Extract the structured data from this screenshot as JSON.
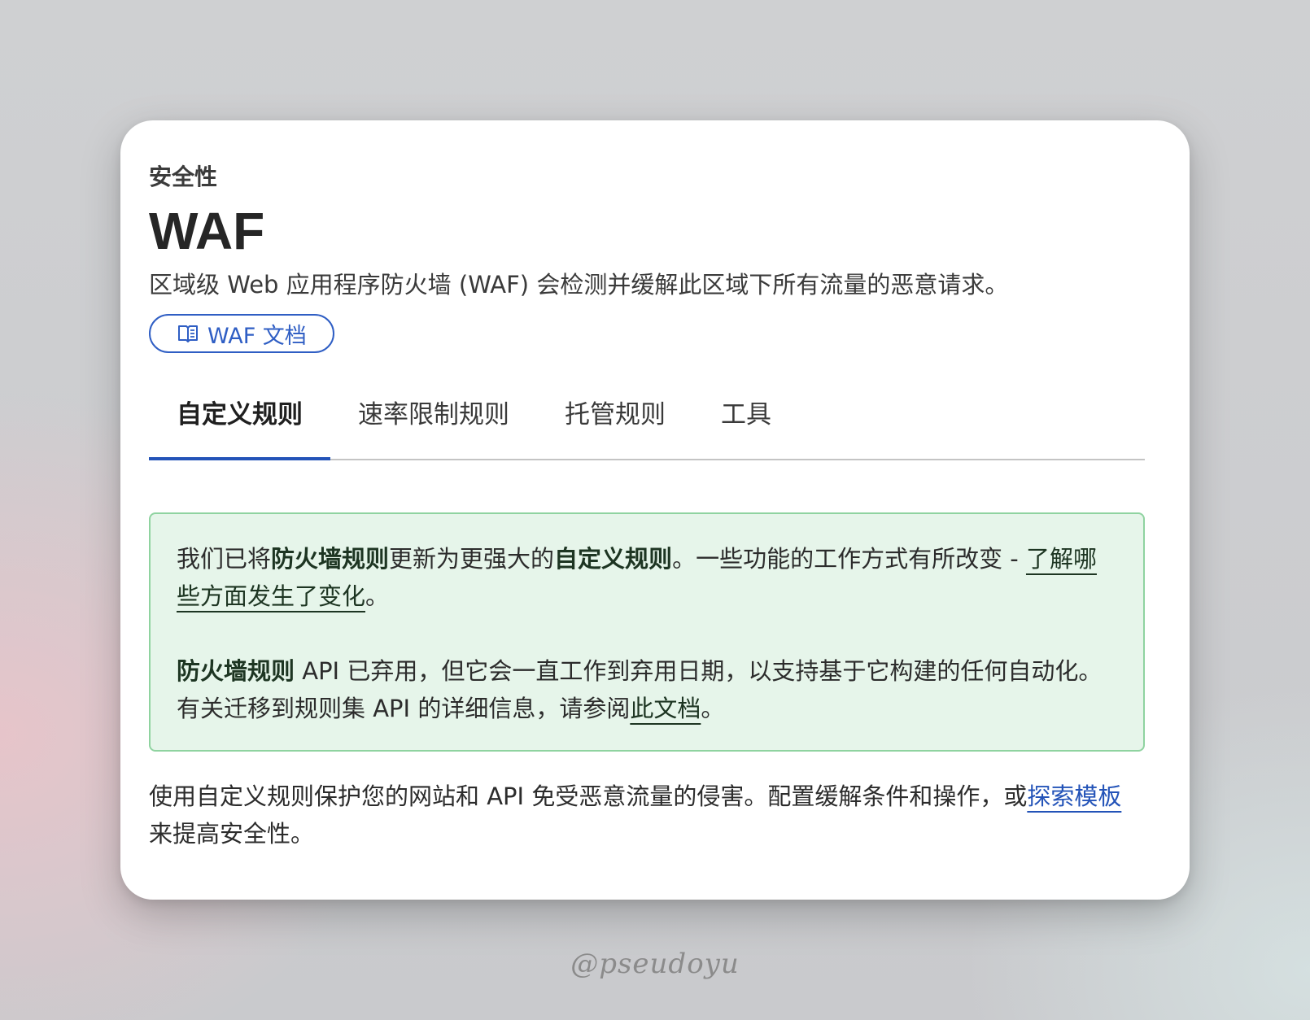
{
  "header": {
    "section": "安全性",
    "title": "WAF",
    "description": "区域级 Web 应用程序防火墙 (WAF) 会检测并缓解此区域下所有流量的恶意请求。",
    "doc_button": {
      "icon": "book-icon",
      "label": "WAF 文档"
    }
  },
  "tabs": [
    {
      "label": "自定义规则",
      "active": true
    },
    {
      "label": "速率限制规则",
      "active": false
    },
    {
      "label": "托管规则",
      "active": false
    },
    {
      "label": "工具",
      "active": false
    }
  ],
  "notice": {
    "p1_prefix": "我们已将",
    "p1_bold1": "防火墙规则",
    "p1_mid": "更新为更强大的",
    "p1_bold2": "自定义规则",
    "p1_suffix": "。一些功能的工作方式有所改变 - ",
    "p1_link": "了解哪些方面发生了变化",
    "p1_end": "。",
    "p2_bold": "防火墙规则",
    "p2_text": " API 已弃用，但它会一直工作到弃用日期，以支持基于它构建的任何自动化。有关迁移到规则集 API 的详细信息，请参阅",
    "p2_link": "此文档",
    "p2_end": "。"
  },
  "body": {
    "text": "使用自定义规则保护您的网站和 API 免受恶意流量的侵害。配置缓解条件和操作，或",
    "link": "探索模板",
    "end": "来提高安全性。"
  },
  "watermark": "@pseudoyu",
  "colors": {
    "accent": "#2353b8",
    "notice_bg": "#e6f5ea",
    "notice_border": "#8fd3a0"
  }
}
